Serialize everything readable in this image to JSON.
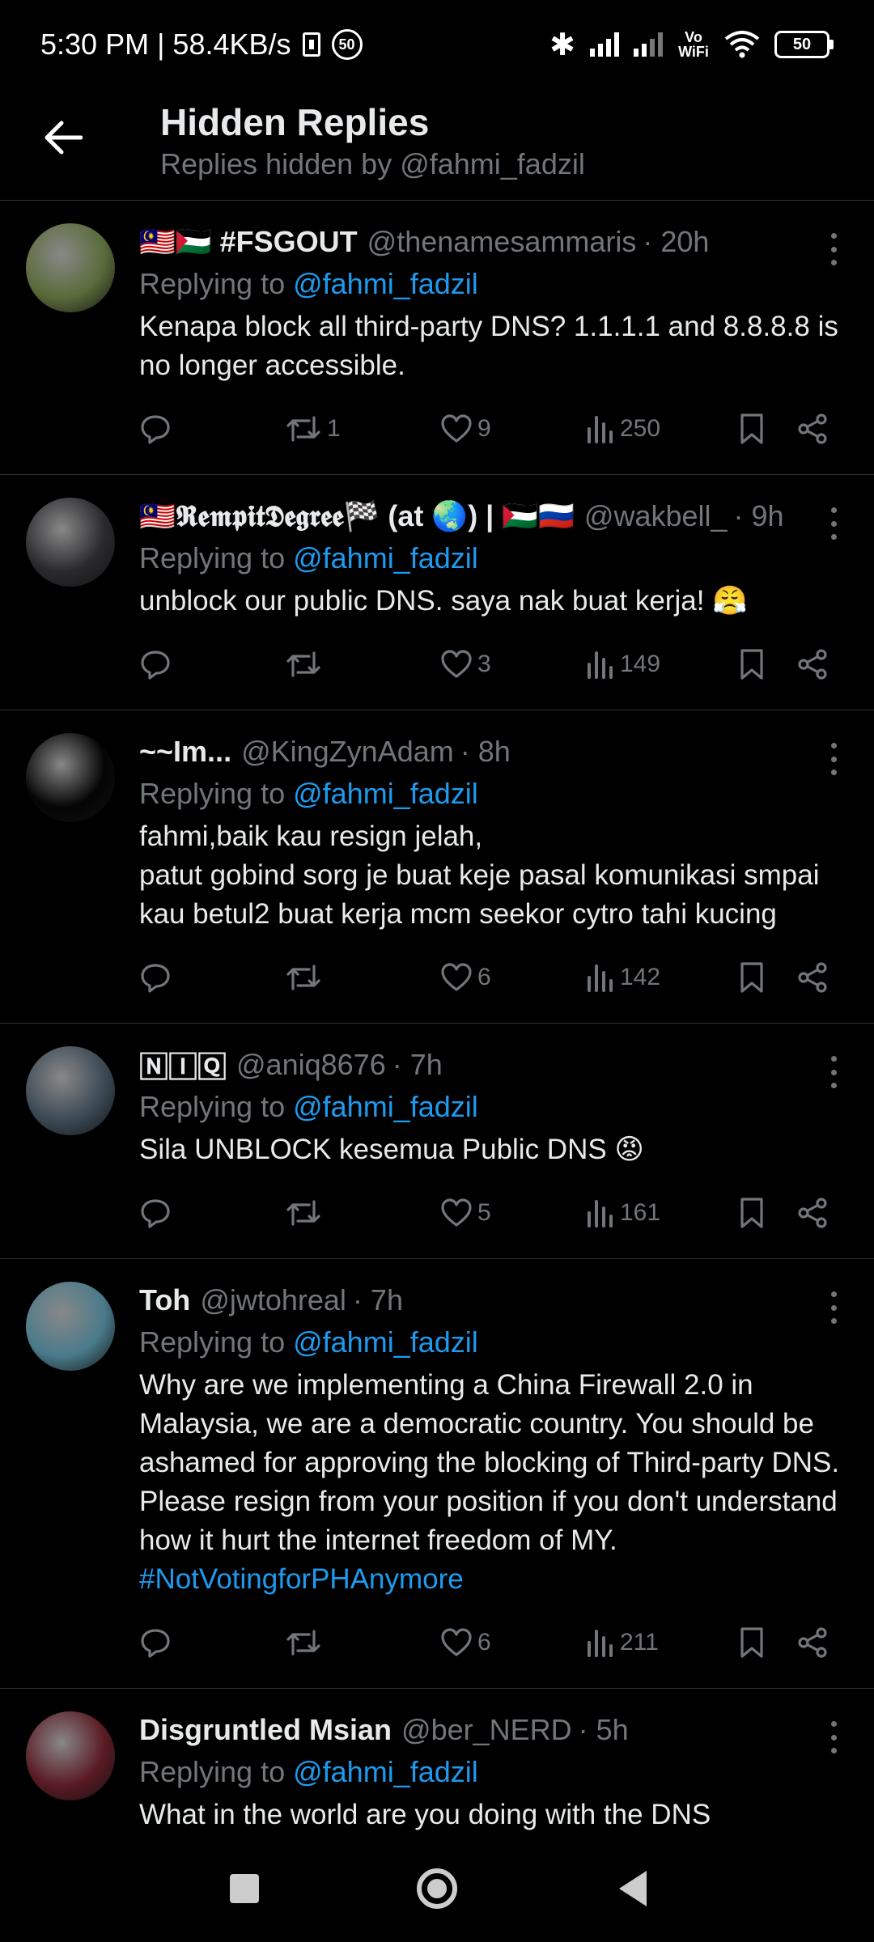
{
  "status_bar": {
    "time_speed": "5:30 PM | 58.4KB/s",
    "notif_badge": "50",
    "network_label": "Vo WiFi",
    "battery": "50"
  },
  "header": {
    "title": "Hidden Replies",
    "subtitle": "Replies hidden by @fahmi_fadzil"
  },
  "replying_prefix": "Replying to ",
  "replying_mention": "@fahmi_fadzil",
  "tweets": [
    {
      "name": "🇲🇾🇵🇸 #FSGOUT",
      "handle": "@thenamesammaris",
      "time": "· 20h",
      "text": "Kenapa block all third-party DNS? 1.1.1.1 and 8.8.8.8 is no longer accessible.",
      "hashtag": "",
      "retweets": "1",
      "likes": "9",
      "views": "250",
      "avatar_color": "#5a6b3a"
    },
    {
      "name": "🇲🇾𝕽𝖊𝖒𝖕𝖎𝖙𝕯𝖊𝖌𝖗𝖊𝖊🏁 (at 🌏) | 🇵🇸🇷🇺",
      "handle": "@wakbell_",
      "time": "· 9h",
      "text": "unblock our public DNS. saya nak buat kerja! 😤",
      "hashtag": "",
      "retweets": "",
      "likes": "3",
      "views": "149",
      "avatar_color": "#2a2a2e"
    },
    {
      "name": "~~Im...",
      "handle": "@KingZynAdam",
      "time": "· 8h",
      "text": "fahmi,baik kau resign jelah,\npatut gobind sorg je buat keje pasal komunikasi smpai kau betul2 buat kerja mcm seekor cytro tahi kucing",
      "hashtag": "",
      "retweets": "",
      "likes": "6",
      "views": "142",
      "avatar_color": "#050505"
    },
    {
      "name": "🄽🄸🅀",
      "handle": "@aniq8676",
      "time": "· 7h",
      "text": "Sila UNBLOCK kesemua Public DNS 😡",
      "hashtag": "",
      "retweets": "",
      "likes": "5",
      "views": "161",
      "avatar_color": "#3c4a55"
    },
    {
      "name": "Toh",
      "handle": "@jwtohreal",
      "time": "· 7h",
      "text": "Why are we implementing a China Firewall 2.0 in Malaysia, we are a democratic country. You should be ashamed for approving the blocking of Third-party DNS. Please resign from your position if you don't understand how it hurt the internet freedom of MY.\n",
      "hashtag": "#NotVotingforPHAnymore",
      "retweets": "",
      "likes": "6",
      "views": "211",
      "avatar_color": "#4a7a8a"
    },
    {
      "name": "Disgruntled Msian",
      "handle": "@ber_NERD",
      "time": "· 5h",
      "text": "What in the world are you doing with the DNS blocks??????!!!",
      "hashtag": "",
      "retweets": "",
      "likes": "",
      "views": "",
      "avatar_color": "#5a1a24"
    }
  ],
  "colors": {
    "background": "#000000",
    "text_primary": "#e7e9ea",
    "text_secondary": "#71767b",
    "accent": "#1d9bf0",
    "divider": "#2f3336"
  },
  "icons": {
    "back": "arrow-left-icon",
    "reply": "comment-icon",
    "retweet": "retweet-icon",
    "like": "heart-icon",
    "views": "bar-chart-icon",
    "bookmark": "bookmark-icon",
    "share": "share-icon",
    "more": "more-vertical-icon"
  }
}
